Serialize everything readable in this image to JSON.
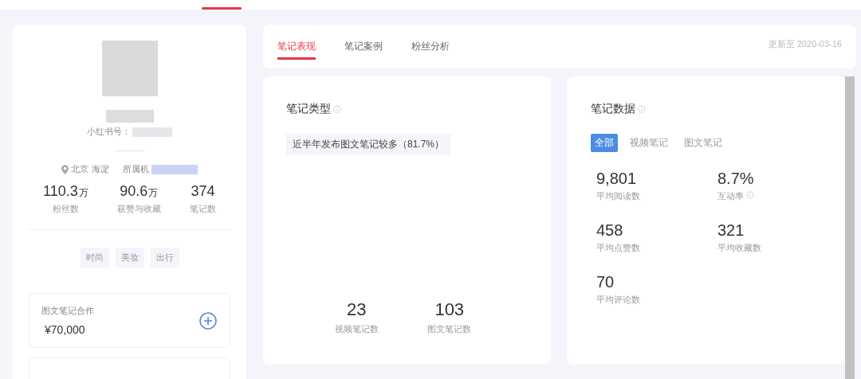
{
  "top_nav": {
    "active_indicator": true
  },
  "profile": {
    "id_label": "小红书号：",
    "location": "北京 海淀",
    "org_label": "所属机",
    "stats": [
      {
        "value": "110.3",
        "unit": "万",
        "label": "粉丝数"
      },
      {
        "value": "90.6",
        "unit": "万",
        "label": "获赞与收藏"
      },
      {
        "value": "374",
        "label": "笔记数"
      }
    ],
    "tags": [
      "时尚",
      "美妆",
      "出行"
    ],
    "pricing": {
      "label": "图文笔记合作",
      "price": "¥70,000"
    }
  },
  "tabs": [
    {
      "label": "笔记表现",
      "selected": true
    },
    {
      "label": "笔记案例",
      "selected": false
    },
    {
      "label": "粉丝分析",
      "selected": false
    }
  ],
  "updated": "更新至 2020-03-16",
  "note_type": {
    "title": "笔记类型",
    "summary": "近半年发布图文笔记较多（81.7%）",
    "counts": [
      {
        "value": "23",
        "label": "视频笔记数"
      },
      {
        "value": "103",
        "label": "图文笔记数"
      }
    ]
  },
  "note_data": {
    "title": "笔记数据",
    "filters": [
      {
        "label": "全部",
        "selected": true
      },
      {
        "label": "视频笔记",
        "selected": false
      },
      {
        "label": "图文笔记",
        "selected": false
      }
    ],
    "metrics": [
      {
        "value": "9,801",
        "label": "平均阅读数",
        "info": false
      },
      {
        "value": "8.7%",
        "label": "互动率",
        "info": true
      },
      {
        "value": "458",
        "label": "平均点赞数",
        "info": false
      },
      {
        "value": "321",
        "label": "平均收藏数",
        "info": false
      },
      {
        "value": "70",
        "label": "平均评论数",
        "info": false
      }
    ]
  }
}
